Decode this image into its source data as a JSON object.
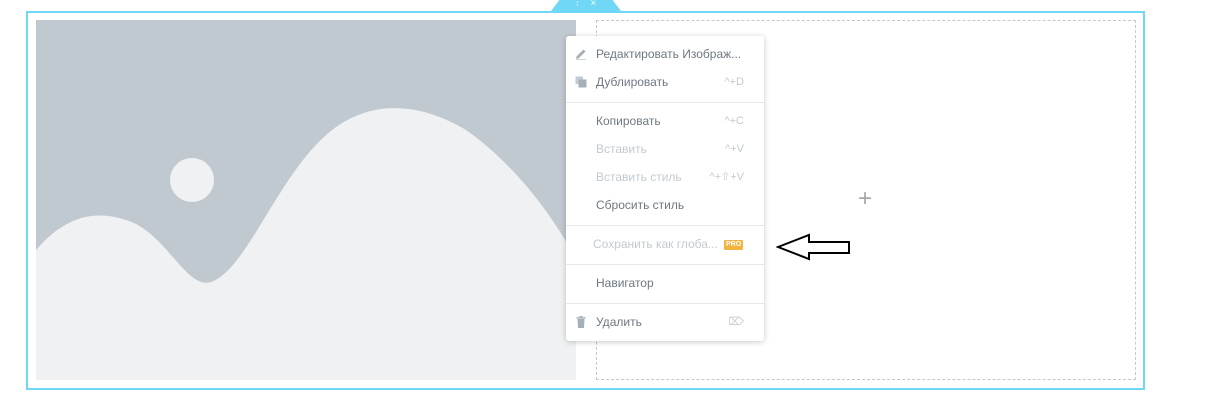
{
  "section": {
    "handle_icons": {
      "drag": "columns-icon",
      "close": "close-icon"
    },
    "handle_glyphs": {
      "drag": "⫶",
      "close": "×"
    }
  },
  "image_widget": {
    "icon": "image-placeholder-icon"
  },
  "empty_column": {
    "add_glyph": "+",
    "icon": "plus-icon"
  },
  "context_menu": {
    "items": [
      {
        "label": "Редактировать Изображ...",
        "shortcut": "",
        "icon": "pencil-icon",
        "disabled": false
      },
      {
        "label": "Дублировать",
        "shortcut": "^+D",
        "icon": "duplicate-icon",
        "disabled": false
      },
      {
        "label": "Копировать",
        "shortcut": "^+C",
        "icon": "",
        "disabled": false
      },
      {
        "label": "Вставить",
        "shortcut": "^+V",
        "icon": "",
        "disabled": true
      },
      {
        "label": "Вставить стиль",
        "shortcut": "^+⇧+V",
        "icon": "",
        "disabled": true
      },
      {
        "label": "Сбросить стиль",
        "shortcut": "",
        "icon": "",
        "disabled": false
      },
      {
        "label": "Сохранить как глоба...",
        "shortcut": "",
        "icon": "",
        "disabled": true,
        "badge": "PRO"
      },
      {
        "label": "Навигатор",
        "shortcut": "",
        "icon": "",
        "disabled": false
      },
      {
        "label": "Удалить",
        "shortcut": "⌦",
        "icon": "trash-icon",
        "disabled": false
      }
    ]
  },
  "annotation": {
    "icon": "arrow-left-icon"
  },
  "colors": {
    "accent": "#71d7f7",
    "placeholder_bg": "#c1c9d0",
    "placeholder_fg": "#eff1f3",
    "pro_badge": "#f2b43f",
    "menu_text": "#6d7882",
    "menu_disabled": "#c2cbd2"
  }
}
